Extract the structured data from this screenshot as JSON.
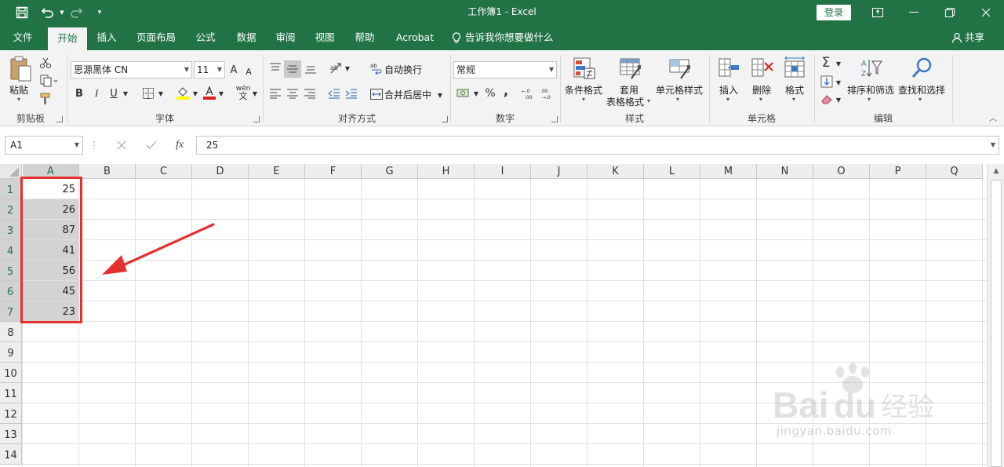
{
  "titlebar": {
    "doc_title": "工作簿1  -  Excel",
    "login_label": "登录",
    "qat_icons": [
      "save-icon",
      "undo-icon",
      "redo-icon",
      "customize-icon"
    ]
  },
  "tabs": [
    "文件",
    "开始",
    "插入",
    "页面布局",
    "公式",
    "数据",
    "审阅",
    "视图",
    "帮助",
    "Acrobat"
  ],
  "active_tab": "开始",
  "tell_me": "告诉我你想要做什么",
  "share_label": "共享",
  "ribbon": {
    "clipboard": {
      "group": "剪贴板",
      "paste": "粘贴"
    },
    "font": {
      "group": "字体",
      "font_name": "思源黑体 CN",
      "font_size": "11",
      "bold": "B",
      "italic": "I",
      "underline": "U",
      "grow": "A",
      "shrink": "A",
      "phonetic": "wén"
    },
    "alignment": {
      "group": "对齐方式",
      "wrap": "自动换行",
      "merge": "合并后居中"
    },
    "number": {
      "group": "数字",
      "format": "常规",
      "percent": "%",
      "comma": ","
    },
    "styles": {
      "group": "样式",
      "conditional": "条件格式",
      "table_line1": "套用",
      "table_line2": "表格格式",
      "cell_styles": "单元格样式"
    },
    "cells": {
      "group": "单元格",
      "insert": "插入",
      "delete": "删除",
      "format": "格式"
    },
    "editing": {
      "group": "编辑",
      "sort": "排序和筛选",
      "find": "查找和选择"
    }
  },
  "formula_bar": {
    "name_box": "A1",
    "fx_label": "fx",
    "value": "25"
  },
  "grid": {
    "columns": [
      "A",
      "B",
      "C",
      "D",
      "E",
      "F",
      "G",
      "H",
      "I",
      "J",
      "K",
      "L",
      "M",
      "N",
      "O",
      "P",
      "Q"
    ],
    "rows": [
      "1",
      "2",
      "3",
      "4",
      "5",
      "6",
      "7",
      "8",
      "9",
      "10",
      "11",
      "12",
      "13",
      "14"
    ],
    "column_a_values": [
      "25",
      "26",
      "87",
      "41",
      "56",
      "45",
      "23"
    ],
    "selected_range": "A1:A7"
  },
  "colors": {
    "accent": "#217346",
    "annotation": "#e02020",
    "selection_fill": "#d3d3d3"
  },
  "watermark": {
    "line1": "Bai 经验",
    "line2": "jingyan.baidu.com"
  }
}
